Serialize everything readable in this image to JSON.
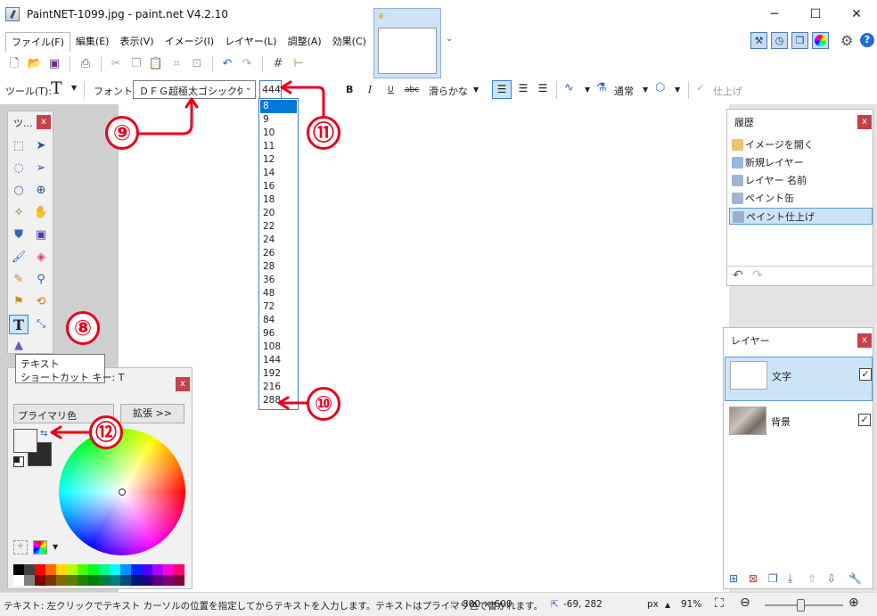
{
  "window": {
    "title": "PaintNET-1099.jpg - paint.net V4.2.10",
    "minimize_glyph": "─",
    "maximize_glyph": "☐",
    "close_glyph": "✕"
  },
  "menu": [
    "ファイル(F)",
    "編集(E)",
    "表示(V)",
    "イメージ(I)",
    "レイヤー(L)",
    "調整(A)",
    "効果(C)"
  ],
  "toolbar2": {
    "tool_label": "ツール(T):",
    "tool_glyph": "T",
    "font_label": "フォント:",
    "font_value": "ＤＦＧ超極太ゴシック体",
    "size_value": "444",
    "bold": "B",
    "italic": "I",
    "underline": "U",
    "strike": "abc",
    "antialias": "滑らかな",
    "blend": "通常",
    "finish": "仕上げ"
  },
  "tools_window": {
    "title": "ツ..."
  },
  "tooltip": {
    "name": "テキスト",
    "shortcut": "ショートカット キー: T"
  },
  "colors_window": {
    "primary_label": "プライマリ色",
    "more_label": "拡張 >>"
  },
  "palette": [
    "#000000",
    "#404040",
    "#ff0000",
    "#ff6a00",
    "#ffd800",
    "#b6ff00",
    "#4cff00",
    "#00ff21",
    "#00ff90",
    "#00ffff",
    "#0094ff",
    "#0026ff",
    "#4800ff",
    "#b200ff",
    "#ff00dc",
    "#ff006e",
    "#ffffff",
    "#808080",
    "#7f0000",
    "#7f3300",
    "#7f6a00",
    "#5b7f00",
    "#267f00",
    "#007f0e",
    "#007f46",
    "#007f7f",
    "#004a7f",
    "#00137f",
    "#21007f",
    "#57007f",
    "#7f006e",
    "#7f0037"
  ],
  "history_window": {
    "title": "履歴",
    "items": [
      "イメージを開く",
      "新規レイヤー",
      "レイヤー 名前",
      "ペイント缶",
      "ペイント仕上げ"
    ],
    "selected_index": 4
  },
  "layers_window": {
    "title": "レイヤー",
    "layers": [
      {
        "name": "文字",
        "visible": true,
        "selected": true
      },
      {
        "name": "背景",
        "visible": true,
        "selected": false
      }
    ]
  },
  "size_options": [
    "8",
    "9",
    "10",
    "11",
    "12",
    "14",
    "16",
    "18",
    "20",
    "22",
    "24",
    "26",
    "28",
    "36",
    "48",
    "72",
    "84",
    "96",
    "108",
    "144",
    "192",
    "216",
    "288"
  ],
  "size_selected_index": 0,
  "markers": [
    "⑧",
    "⑨",
    "⑩",
    "⑪",
    "⑫"
  ],
  "status": {
    "hint": "テキスト: 左クリックでテキスト カーソルの位置を指定してからテキストを入力します。テキストはプライマリ色で書かれます。",
    "image_size": "800 × 600",
    "cursor_pos": "-69, 282",
    "unit": "px",
    "zoom": "91%"
  },
  "colors": {
    "accent": "#3c7fcf",
    "marker": "#e8001d",
    "selection": "#cce4f7"
  }
}
